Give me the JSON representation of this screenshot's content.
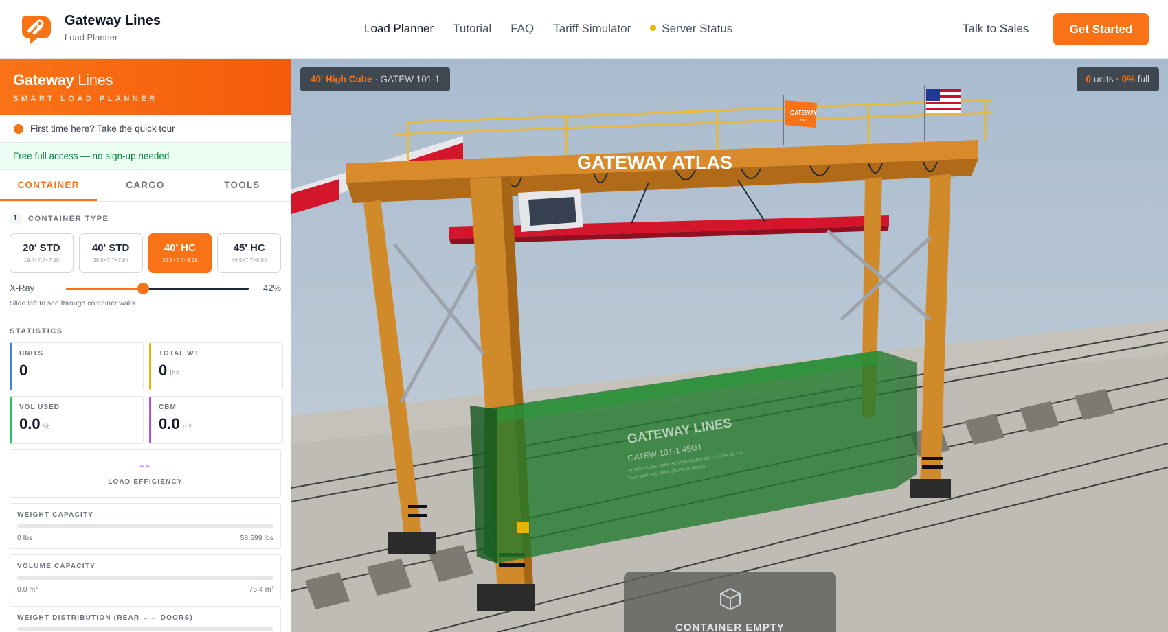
{
  "header": {
    "brand_name": "Gateway Lines",
    "brand_sub": "Load Planner",
    "nav": [
      "Load Planner",
      "Tutorial",
      "FAQ",
      "Tariff Simulator",
      "Server Status"
    ],
    "talk_to_sales": "Talk to Sales",
    "get_started": "Get Started",
    "status_color": "#eab308",
    "accent": "#f97316"
  },
  "sidebar": {
    "brand_bold": "Gateway",
    "brand_light": " Lines",
    "tagline": "SMART LOAD PLANNER",
    "tour": "First time here? Take the quick tour",
    "free_access": "Free full access — no sign-up needed",
    "tabs": [
      "CONTAINER",
      "CARGO",
      "TOOLS"
    ],
    "container_type": {
      "step": "1",
      "label": "CONTAINER TYPE",
      "options": [
        {
          "name": "20' STD",
          "dims": "19.4×7.7×7.9ft"
        },
        {
          "name": "40' STD",
          "dims": "39.5×7.7×7.9ft"
        },
        {
          "name": "40' HC",
          "dims": "39.5×7.7×8.9ft"
        },
        {
          "name": "45' HC",
          "dims": "44.5×7.7×8.9ft"
        }
      ],
      "selected_index": 2
    },
    "xray": {
      "label": "X-Ray",
      "value_text": "42%",
      "value": 0.42,
      "hint": "Slide left to see through container walls"
    },
    "statistics": {
      "label": "STATISTICS",
      "units": {
        "label": "UNITS",
        "value": "0"
      },
      "total_wt": {
        "label": "TOTAL WT",
        "value": "0",
        "unit": "lbs"
      },
      "vol_used": {
        "label": "VOL USED",
        "value": "0.0",
        "unit": "%"
      },
      "cbm": {
        "label": "CBM",
        "value": "0.0",
        "unit": "m³"
      },
      "load_efficiency": {
        "value": "--",
        "label": "LOAD EFFICIENCY"
      },
      "weight_capacity": {
        "label": "WEIGHT CAPACITY",
        "min": "0 lbs",
        "max": "58,599 lbs",
        "fill": 0
      },
      "volume_capacity": {
        "label": "VOLUME CAPACITY",
        "min": "0.0 m³",
        "max": "76.4 m³",
        "fill": 0
      },
      "weight_distribution": {
        "label": "WEIGHT DISTRIBUTION (REAR ←→ DOORS)"
      }
    }
  },
  "viewport": {
    "badge_left_highlight": "40' High Cube",
    "badge_left_rest": " · GATEW 101-1",
    "badge_right_units": "0",
    "badge_right_units_label": " units ",
    "badge_right_full": "· 0%",
    "badge_right_full_label": " full",
    "crane_sign": "GATEWAY ATLAS",
    "flag_text": "GATEWAY",
    "flag_subtext": "LINES",
    "container_brand": "GATEWAY LINES",
    "container_id": "GATEW 101-1  45G1",
    "container_detail_1": "40' HIGH CUBE · MAX PAYLOAD 26,580 KG · CU CAP 76.4 M³",
    "container_detail_2": "TARE 3,800 KG · MAX GROSS 30,480 KG",
    "empty_message": "CONTAINER EMPTY"
  }
}
